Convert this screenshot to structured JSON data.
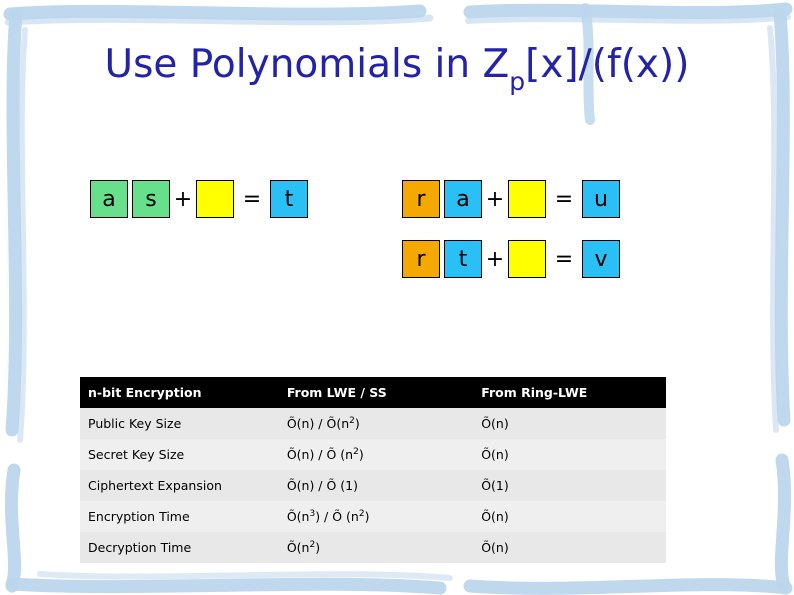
{
  "slide": {
    "title_main": "Use Polynomials in Z",
    "title_sub": "p",
    "title_rest": "[x]/(f(x))"
  },
  "equations": {
    "left": [
      {
        "cells": [
          {
            "label": "a",
            "color": "green"
          },
          {
            "label": "s",
            "color": "green"
          },
          {
            "op": "+"
          },
          {
            "label": "",
            "color": "yellow"
          },
          {
            "op": "="
          },
          {
            "label": "t",
            "color": "cyan"
          }
        ]
      }
    ],
    "right": [
      {
        "cells": [
          {
            "label": "r",
            "color": "orange"
          },
          {
            "label": "a",
            "color": "cyan"
          },
          {
            "op": "+"
          },
          {
            "label": "",
            "color": "yellow"
          },
          {
            "op": "="
          },
          {
            "label": "u",
            "color": "cyan"
          }
        ]
      },
      {
        "cells": [
          {
            "label": "r",
            "color": "orange"
          },
          {
            "label": "t",
            "color": "cyan"
          },
          {
            "op": "+"
          },
          {
            "label": "",
            "color": "yellow"
          },
          {
            "op": "="
          },
          {
            "label": "v",
            "color": "cyan"
          }
        ]
      }
    ]
  },
  "table": {
    "headers": [
      "n-bit Encryption",
      "From LWE / SS",
      "From Ring-LWE"
    ],
    "rows": [
      {
        "label": "Public Key Size",
        "lwe": "Õ(n) / Õ(n2)",
        "ring": "Õ(n)"
      },
      {
        "label": "Secret Key Size",
        "lwe": "Õ(n) / Õ (n2)",
        "ring": "Õ(n)"
      },
      {
        "label": "Ciphertext Expansion",
        "lwe": "Õ(n) / Õ (1)",
        "ring": "Õ(1)"
      },
      {
        "label": "Encryption Time",
        "lwe": "Õ(n3) / Õ (n2)",
        "ring": "Õ(n)"
      },
      {
        "label": "Decryption Time",
        "lwe": "Õ(n2)",
        "ring": "Õ(n)"
      }
    ]
  },
  "colors": {
    "title": "#2222aa",
    "green": "#66e08a",
    "yellow": "#ffff00",
    "cyan": "#2bc0f5",
    "orange": "#f5a800",
    "header_bg": "#000000",
    "row_bg": "#e8e8e8",
    "frame": "#b9d3ea"
  }
}
